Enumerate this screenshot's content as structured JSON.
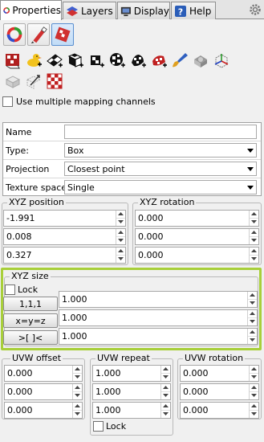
{
  "tabs": [
    {
      "label": "Properties",
      "icon": "properties-icon",
      "active": true
    },
    {
      "label": "Layers",
      "icon": "layers-icon",
      "active": false
    },
    {
      "label": "Display",
      "icon": "display-icon",
      "active": false
    },
    {
      "label": "Help",
      "icon": "help-icon",
      "active": false
    }
  ],
  "use_multiple_mapping": {
    "label": "Use multiple mapping channels",
    "checked": false
  },
  "props": {
    "name_label": "Name",
    "name_value": "",
    "type_label": "Type:",
    "type_value": "Box",
    "projection_label": "Projection",
    "projection_value": "Closest point",
    "texture_space_label": "Texture space",
    "texture_space_value": "Single"
  },
  "xyz_position": {
    "title": "XYZ position",
    "values": [
      "-1.991",
      "0.008",
      "0.327"
    ]
  },
  "xyz_rotation": {
    "title": "XYZ rotation",
    "values": [
      "0.000",
      "0.000",
      "0.000"
    ]
  },
  "xyz_size": {
    "title": "XYZ size",
    "lock_label": "Lock",
    "lock_checked": false,
    "buttons": [
      "1,1,1",
      "x=y=z",
      ">[ ]<"
    ],
    "values": [
      "1.000",
      "1.000",
      "1.000"
    ]
  },
  "uvw_offset": {
    "title": "UVW offset",
    "values": [
      "0.000",
      "0.000",
      "0.000"
    ]
  },
  "uvw_repeat": {
    "title": "UVW repeat",
    "values": [
      "1.000",
      "1.000",
      "1.000"
    ],
    "lock_label": "Lock"
  },
  "uvw_rotation": {
    "title": "UVW rotation",
    "values": [
      "0.000",
      "0.000",
      "0.000"
    ]
  },
  "colors": {
    "highlight": "#a8cf3a",
    "tab_border": "#8e8f8f"
  }
}
